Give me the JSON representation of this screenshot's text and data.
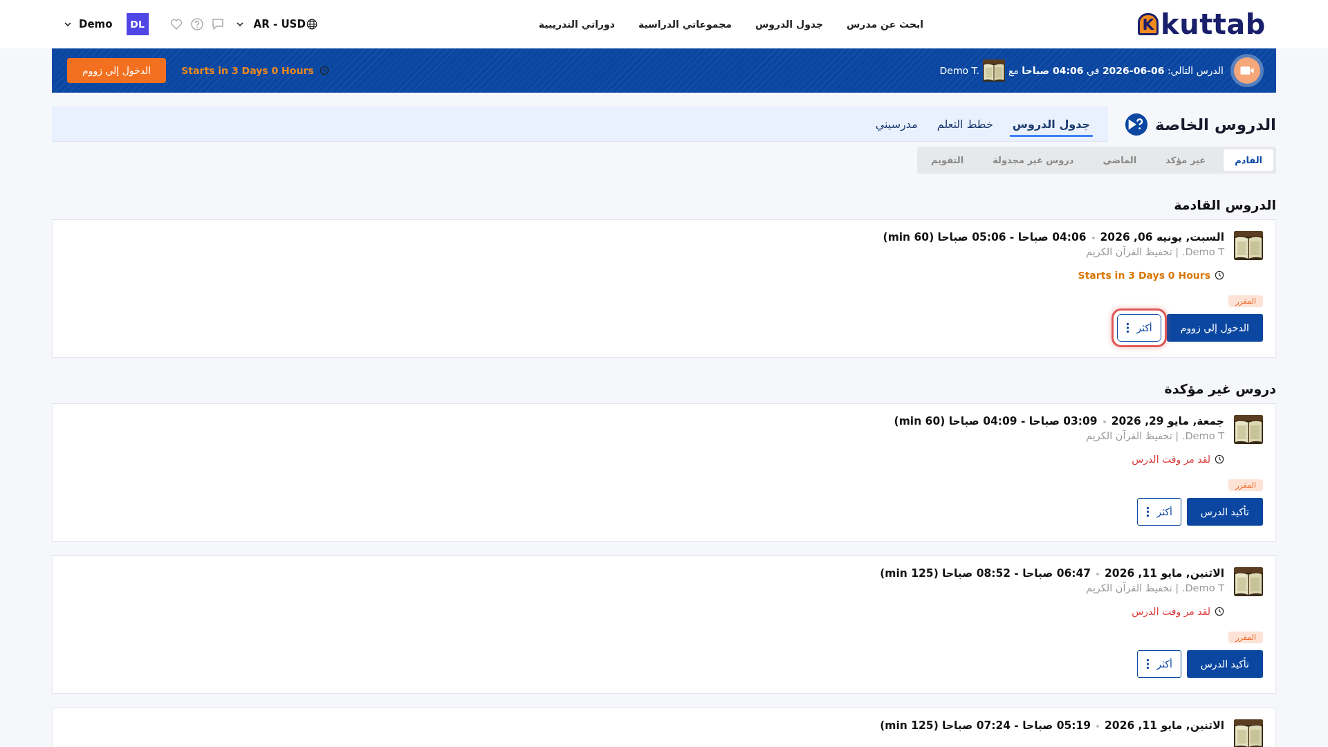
{
  "header": {
    "logo": {
      "mark": "K",
      "text": "kuttab"
    },
    "nav": [
      "ابحث عن مدرس",
      "جدول الدروس",
      "مجموعاتي الدراسية",
      "دوراتي التدريبية"
    ],
    "locale": "AR - USD",
    "user": {
      "initials": "DL",
      "name": "Demo"
    }
  },
  "banner": {
    "text": "الدرس التالي: **06-06-2026** في **04:06 صباحا** مع",
    "teacher": "Demo T.",
    "countdown": "Starts in 3 Days 0 Hours",
    "button": "الدخول إلي زووم"
  },
  "page": {
    "title": "الدروس الخاصة",
    "tabs": [
      {
        "label": "جدول الدروس",
        "selected": true
      },
      {
        "label": "خطط التعلم",
        "selected": false
      },
      {
        "label": "مدرسيني",
        "selected": false
      }
    ],
    "filters": [
      {
        "label": "القادم",
        "selected": true
      },
      {
        "label": "غير مؤكد",
        "selected": false
      },
      {
        "label": "الماضي",
        "selected": false
      },
      {
        "label": "دروس غير مجدولة",
        "selected": false
      },
      {
        "label": "التقويم",
        "selected": false
      }
    ]
  },
  "sections": [
    {
      "title": "الدروس القادمة",
      "lessons": [
        {
          "date": "السبت, يونيه 06, 2026",
          "time": "04:06 صباحا - 05:06 صباحا (60 min)",
          "subtitle": "Demo T. | تخفيظ القرآن الكريم",
          "status": {
            "kind": "upcoming",
            "text": "Starts in 3 Days 0 Hours"
          },
          "badge": "المقرر",
          "primary": "الدخول إلي زووم",
          "more": {
            "label": "أكثر",
            "highlighted": true
          }
        }
      ]
    },
    {
      "title": "دروس غير مؤكدة",
      "lessons": [
        {
          "date": "جمعة, مايو 29, 2026",
          "time": "03:09 صباحا - 04:09 صباحا (60 min)",
          "subtitle": "Demo T. | تخفيظ القرآن الكريم",
          "status": {
            "kind": "missed",
            "text": "لقد مر وقت الدرس"
          },
          "badge": "المقرر",
          "primary": "تأكيد الدرس",
          "more": {
            "label": "أكثر",
            "highlighted": false
          }
        },
        {
          "date": "الاثنين, مايو 11, 2026",
          "time": "06:47 صباحا - 08:52 صباحا (125 min)",
          "subtitle": "Demo T. | تخفيظ القرآن الكريم",
          "status": {
            "kind": "missed",
            "text": "لقد مر وقت الدرس"
          },
          "badge": "المقرر",
          "primary": "تأكيد الدرس",
          "more": {
            "label": "أكثر",
            "highlighted": false
          }
        },
        {
          "date": "الاثنين, مايو 11, 2026",
          "time": "05:19 صباحا - 07:24 صباحا (125 min)"
        }
      ]
    }
  ]
}
